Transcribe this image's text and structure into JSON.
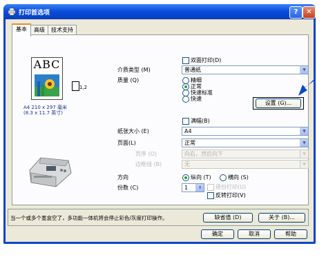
{
  "window": {
    "title": "打印首选项",
    "help_glyph": "?",
    "close_glyph": "✕"
  },
  "tabs": [
    {
      "label": "基本",
      "active": true
    },
    {
      "label": "高级",
      "active": false
    },
    {
      "label": "技术支持",
      "active": false
    }
  ],
  "preview": {
    "sample_text": "ABC",
    "copies_indicator": "1,2",
    "paper_size_line1": "A4 210 x 297 毫米",
    "paper_size_line2": "(8.3 x 11.7 英寸)"
  },
  "media": {
    "manual_duplex_label": "双面打印",
    "manual_duplex_shortcut": "(D)",
    "manual_duplex_checked": false,
    "media_type_label": "介质类型",
    "media_type_shortcut": "(M)",
    "media_type_value": "普通纸",
    "quality_label": "质量",
    "quality_shortcut": "(Q)",
    "quality_options": [
      "精细",
      "正常",
      "快速标准",
      "快速"
    ],
    "quality_selected_index": 1,
    "settings_button": "设置 (G)..."
  },
  "paper": {
    "borderless_label": "满幅",
    "borderless_shortcut": "(B)",
    "borderless_checked": false,
    "paper_size_label": "纸张大小",
    "paper_size_shortcut": "(E)",
    "paper_size_value": "A4",
    "page_label": "页面",
    "page_shortcut": "(L)",
    "page_value": "正常",
    "page_order_label": "页序",
    "page_order_shortcut": "(O)",
    "page_order_value": "向右，然后向下",
    "border_line_label": "边框线",
    "border_line_shortcut": "(B)",
    "border_line_value": "无"
  },
  "orientation": {
    "label": "方向",
    "portrait_label": "纵向",
    "portrait_shortcut": "(T)",
    "landscape_label": "横向",
    "landscape_shortcut": "(S)",
    "selected": "portrait"
  },
  "copies": {
    "label": "份数",
    "shortcut": "(C)",
    "value": "1",
    "collate_label": "逐份打印",
    "collate_shortcut": "(U)",
    "reverse_label": "反转打印",
    "reverse_shortcut": "(V)"
  },
  "status": {
    "message": "当一个或多个墨盒空了，多功能一体机将会停止彩色/灰度打印操作。",
    "default_button": "缺省值 (D)",
    "about_button": "关于 (B)..."
  },
  "footer": {
    "ok": "确定",
    "cancel": "取消",
    "help": "帮助"
  },
  "colors": {
    "title_bar": "#0b4fdc",
    "dialog_face": "#ece9d8",
    "arrow": "#0a48c8"
  }
}
